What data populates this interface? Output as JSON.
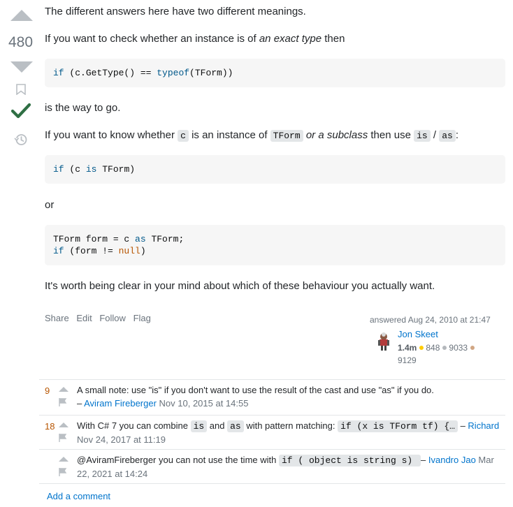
{
  "vote": {
    "score": "480"
  },
  "post": {
    "p1": "The different answers here have two different meanings.",
    "p2_a": "If you want to check whether an instance is of ",
    "p2_em": "an exact type",
    "p2_b": " then",
    "code1": {
      "k1": "if",
      "t1": " (c.GetType() == ",
      "k2": "typeof",
      "t2": "(TForm))"
    },
    "p3": "is the way to go.",
    "p4_a": "If you want to know whether ",
    "p4_c1": "c",
    "p4_b": " is an instance of ",
    "p4_c2": "TForm",
    "p4_em": " or a subclass",
    "p4_d": " then use ",
    "p4_c3": "is",
    "p4_slash": " / ",
    "p4_c4": "as",
    "p4_colon": ":",
    "code2": {
      "k1": "if",
      "t1": " (c ",
      "k2": "is",
      "t2": " TForm)"
    },
    "p5": "or",
    "code3": {
      "l1_t1": "TForm form = c ",
      "l1_k1": "as",
      "l1_t2": " TForm;",
      "l2_k1": "if",
      "l2_t1": " (form != ",
      "l2_lit": "null",
      "l2_t2": ")"
    },
    "p6": "It's worth being clear in your mind about which of these behaviour you actually want."
  },
  "menu": {
    "share": "Share",
    "edit": "Edit",
    "follow": "Follow",
    "flag": "Flag"
  },
  "signature": {
    "answered": "answered Aug 24, 2010 at 21:47",
    "user": "Jon Skeet",
    "rep": "1.4m",
    "gold": "848",
    "silver": "9033",
    "bronze": "9129",
    "colors": {
      "gold": "#ffcc01",
      "silver": "#b4b8bc",
      "bronze": "#d1a684"
    }
  },
  "comments": [
    {
      "score": "9",
      "text": "A small note: use \"is\" if you don't want to use the result of the cast and use \"as\" if you do.",
      "dash": " – ",
      "user": "Aviram Fireberger",
      "date": " Nov 10, 2015 at 14:55"
    },
    {
      "score": "18",
      "text_a": "With C# 7 you can combine ",
      "code_a": "is",
      "text_b": " and ",
      "code_b": "as",
      "text_c": " with pattern matching: ",
      "code_c": "if (x is TForm tf) {…",
      "dash": " – ",
      "user": "Richard",
      "date": "Nov 24, 2017 at 11:19"
    },
    {
      "score": "",
      "text_a": "@AviramFireberger you can not use the time with ",
      "code_a": "if ( object is string s) ",
      "dash": " – ",
      "user": "Ivandro Jao",
      "date_a": " Mar",
      "date_b": "22, 2021 at 14:24"
    }
  ],
  "add_comment": "Add a comment"
}
